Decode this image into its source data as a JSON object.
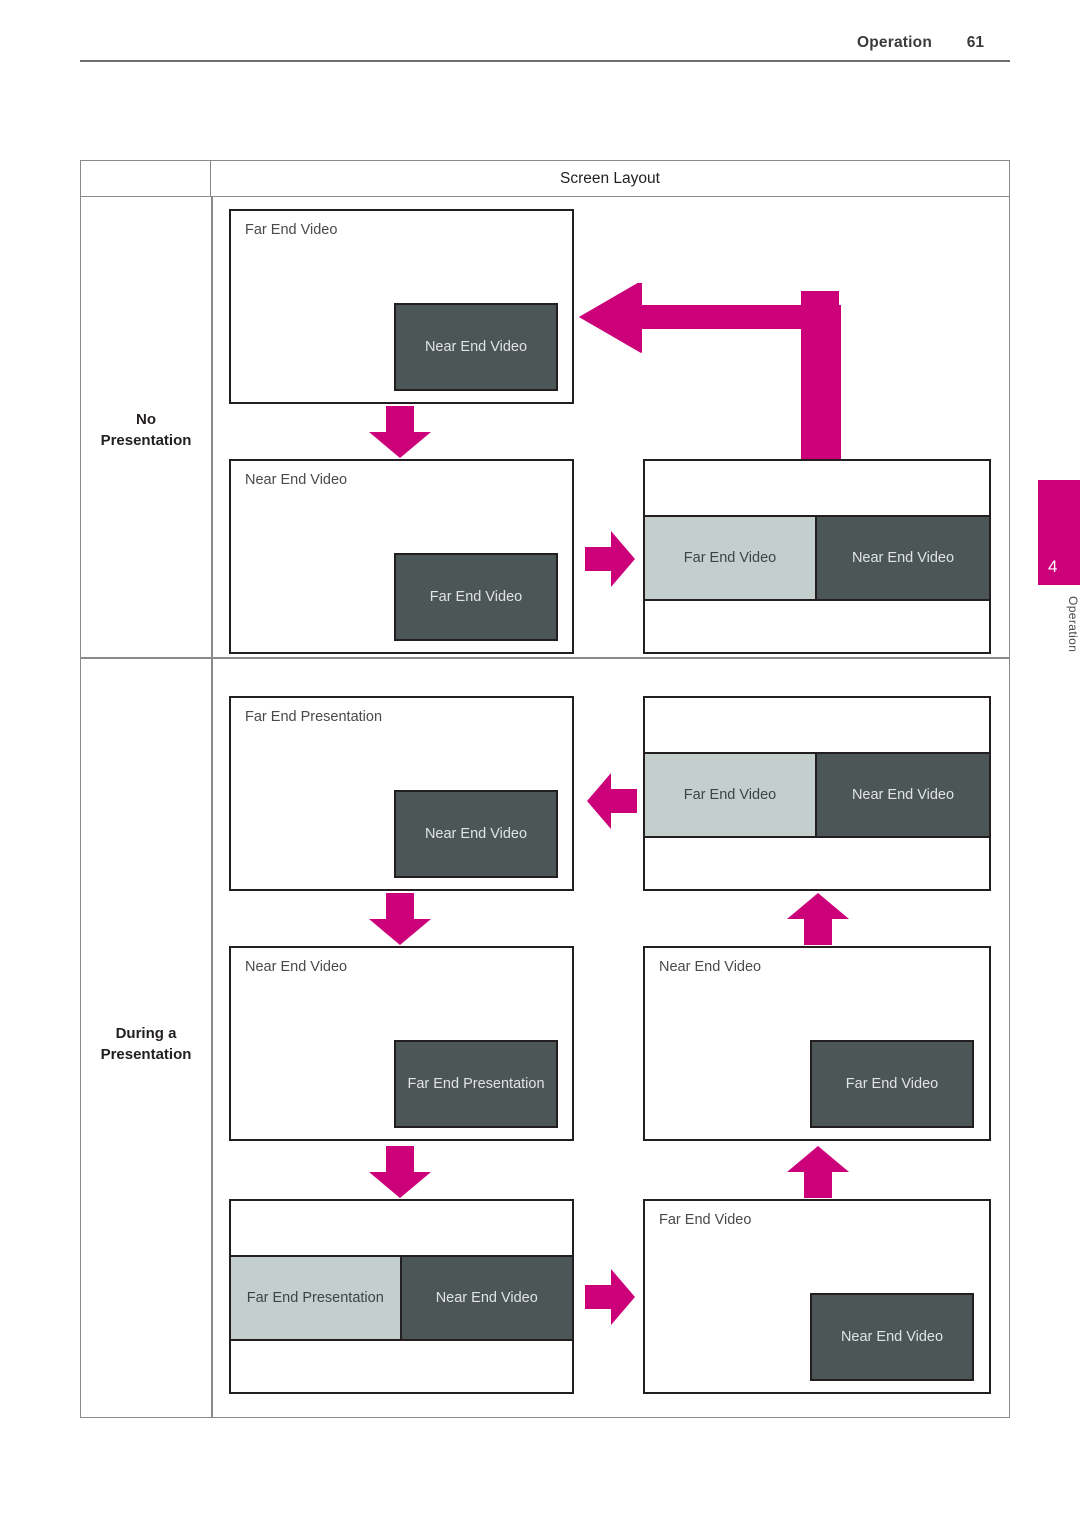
{
  "header": {
    "title": "Operation",
    "page_number": "61"
  },
  "side_tab": {
    "number": "4",
    "label": "Operation",
    "color": "#cc0078"
  },
  "table": {
    "column_header": "Screen Layout",
    "rows": [
      {
        "label_line1": "No",
        "label_line2": "Presentation"
      },
      {
        "label_line1": "During a",
        "label_line2": "Presentation"
      }
    ]
  },
  "colors": {
    "accent": "#cc0078",
    "pip_dark": "#4d5656",
    "split_light": "#c4cfcd",
    "panel_border": "#231f20",
    "table_border": "#8a8a8a"
  },
  "panels": {
    "r1_p1": {
      "title": "Far End Video",
      "pip": "Near End Video"
    },
    "r1_p2": {
      "title": "Near End Video",
      "pip": "Far End Video"
    },
    "r1_p3": {
      "split_left": "Far End Video",
      "split_right": "Near End Video"
    },
    "r2_p1": {
      "title": "Far End Presentation",
      "pip": "Near End Video"
    },
    "r2_p2": {
      "split_left": "Far End Video",
      "split_right": "Near End Video"
    },
    "r2_p3": {
      "title": "Near End Video",
      "pip": "Far End Presentation"
    },
    "r2_p4": {
      "title": "Near End Video",
      "pip": "Far End Video"
    },
    "r2_p5": {
      "split_left": "Far End Presentation",
      "split_right": "Near End Video"
    },
    "r2_p6": {
      "title": "Far End Video",
      "pip": "Near End Video"
    }
  },
  "arrows": {
    "elbow_up_left": "elbow-arrow-up-left",
    "down_1": "arrow-down",
    "right_1": "arrow-right",
    "left_1": "arrow-left",
    "down_2": "arrow-down",
    "up_1": "arrow-up",
    "down_3": "arrow-down",
    "up_2": "arrow-up",
    "right_2": "arrow-right"
  }
}
